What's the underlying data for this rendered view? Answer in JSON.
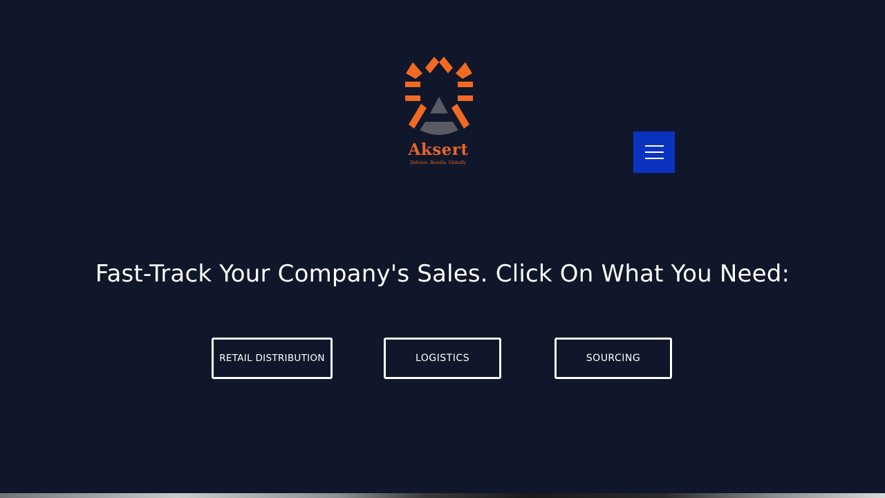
{
  "brand": {
    "name": "Aksert",
    "tagline": "Delivers. Results. Globally.",
    "logo_icon": "aksert-sunburst-logo",
    "accent_color": "#e8642a"
  },
  "header": {
    "menu_icon": "hamburger-icon",
    "menu_button_color": "#0b33c0"
  },
  "hero": {
    "headline": "Fast-Track Your Company's Sales. Click On What You Need:",
    "buttons": [
      {
        "label": "RETAIL DISTRIBUTION"
      },
      {
        "label": "LOGISTICS"
      },
      {
        "label": "SOURCING"
      }
    ],
    "background_color": "#10172a"
  }
}
